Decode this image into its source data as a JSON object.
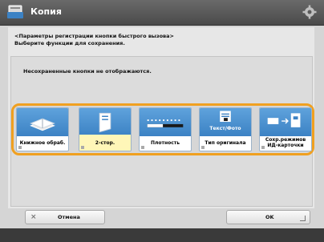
{
  "window": {
    "title": "Копия"
  },
  "instructions": {
    "line1": "<Параметры регистрации кнопки быстрого вызова>",
    "line2": "Выберите функции для сохранения."
  },
  "panel": {
    "message": "Несохраненные кнопки не отображаются."
  },
  "functions": [
    {
      "label": "Книжное обраб.",
      "icon": "book-icon",
      "selected": false
    },
    {
      "label": "2-стор.",
      "icon": "two-sided-icon",
      "selected": true
    },
    {
      "label": "Плотность",
      "icon": "density-icon",
      "selected": false
    },
    {
      "label": "Тип оригинала",
      "icon": "original-type-icon",
      "label_icon": "Текст/Фото",
      "selected": false
    },
    {
      "label": "Сохр.режимов ИД-карточки",
      "icon": "id-card-icon",
      "selected": false
    }
  ],
  "buttons": {
    "cancel": "Отмена",
    "ok": "OK"
  },
  "colors": {
    "title_bar": "#4a4a4a",
    "selection_border": "#f0a020",
    "tile_header": "#3c82c4",
    "selected_tile": "#fff6b8"
  }
}
